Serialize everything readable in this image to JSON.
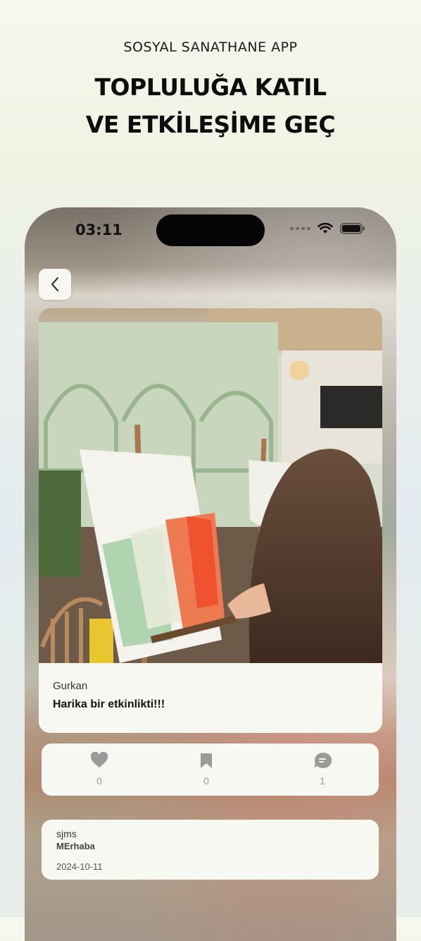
{
  "hero": {
    "subtitle": "SOSYAL SANATHANE APP",
    "title_line1": "TOPLULUĞA KATIL",
    "title_line2": "VE ETKİLEŞİME GEÇ"
  },
  "status_bar": {
    "time": "03:11"
  },
  "post": {
    "author": "Gurkan",
    "caption": "Harika bir etkinlikti!!!"
  },
  "actions": {
    "likes": "0",
    "bookmarks": "0",
    "comments": "1"
  },
  "comment": {
    "user": "sjms",
    "text": "MErhaba",
    "date": "2024-10-11"
  },
  "colors": {
    "card_bg": "#f8f8f2",
    "icon_gray": "#9a9a9a",
    "title_black": "#0c0c0c"
  }
}
